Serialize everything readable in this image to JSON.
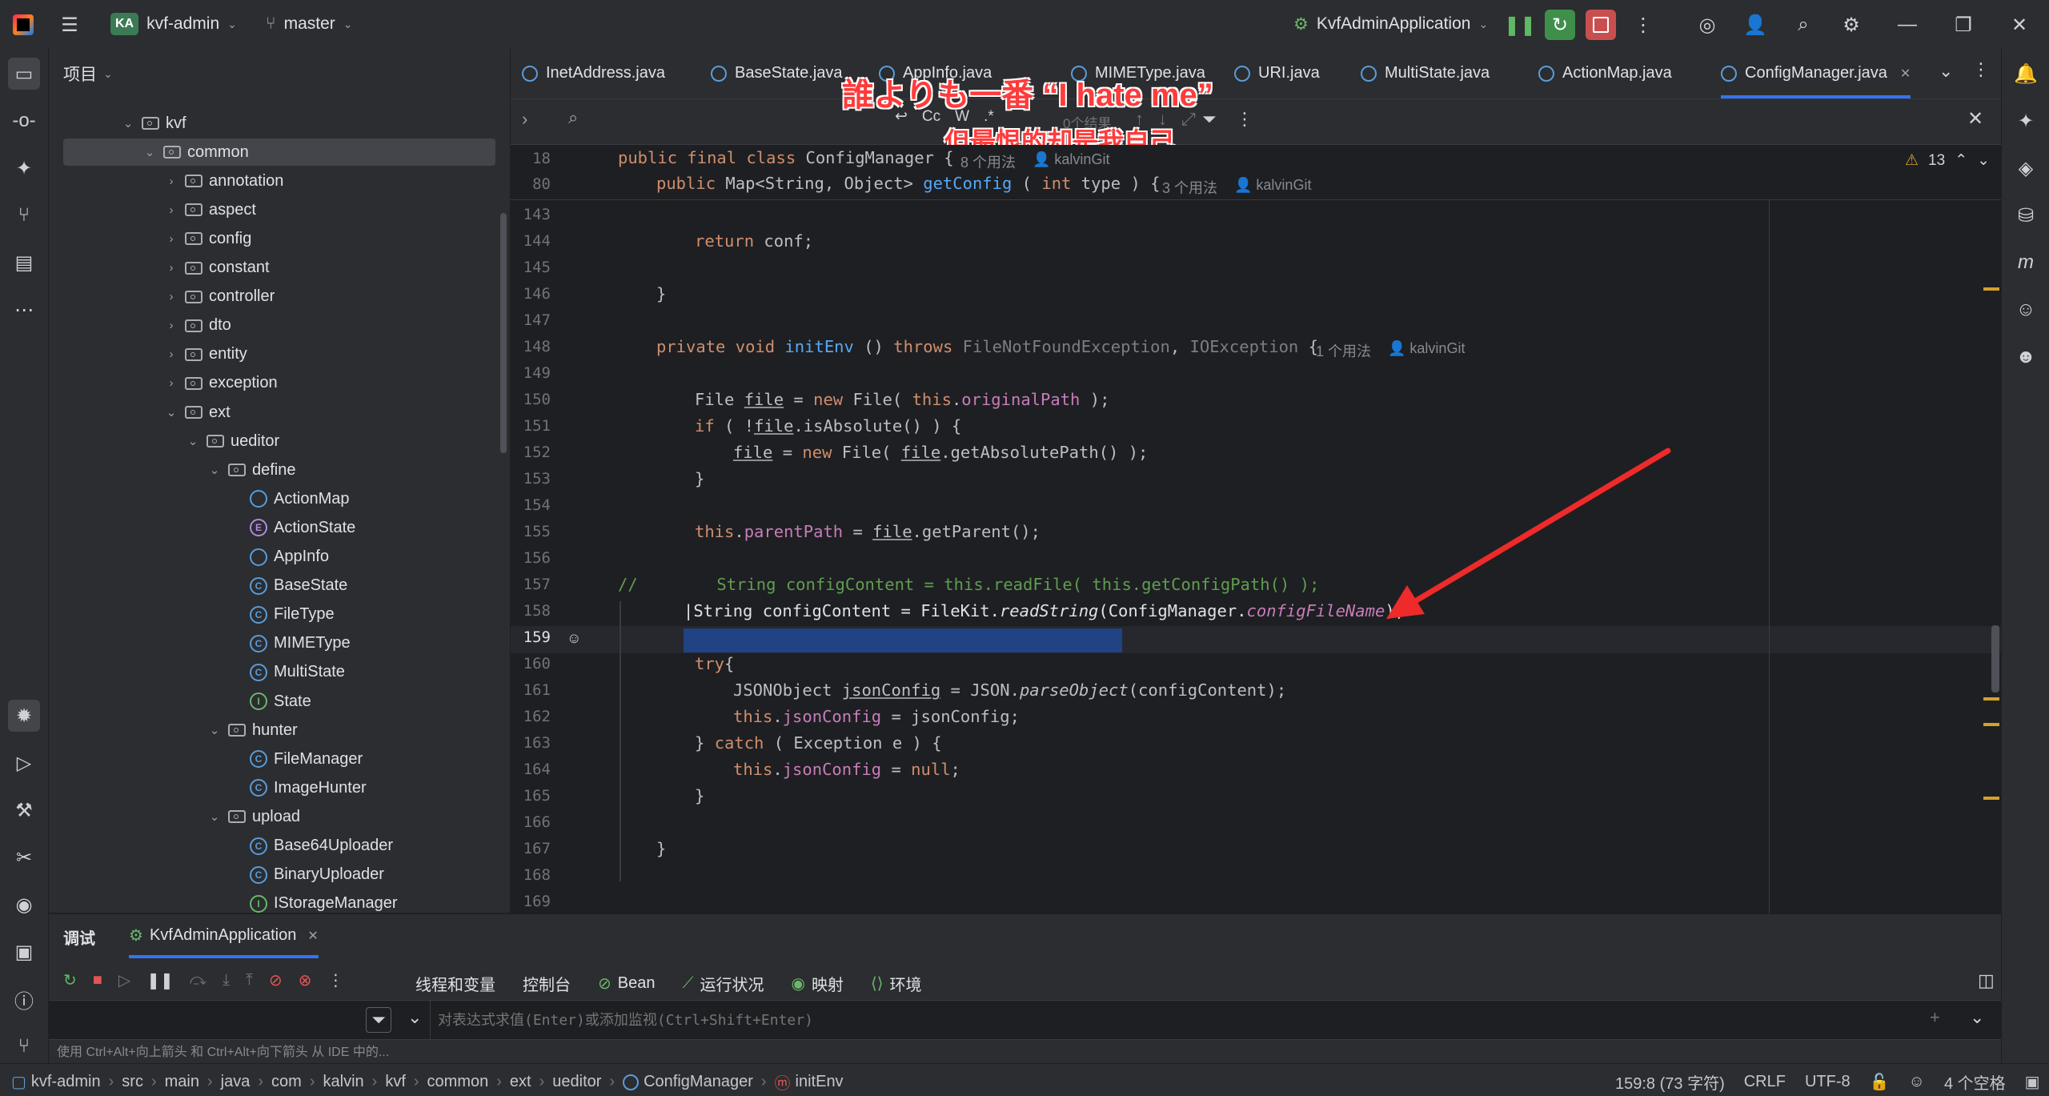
{
  "title_bar": {
    "project_badge": "KA",
    "project_name": "kvf-admin",
    "branch": "master",
    "run_config": "KvfAdminApplication"
  },
  "project_panel": {
    "title": "项目",
    "tree": [
      {
        "label": "kvf",
        "kind": "folder",
        "expanded": true
      },
      {
        "label": "common",
        "kind": "folder",
        "expanded": true
      },
      {
        "label": "annotation",
        "kind": "folder"
      },
      {
        "label": "aspect",
        "kind": "folder"
      },
      {
        "label": "config",
        "kind": "folder"
      },
      {
        "label": "constant",
        "kind": "folder"
      },
      {
        "label": "controller",
        "kind": "folder"
      },
      {
        "label": "dto",
        "kind": "folder"
      },
      {
        "label": "entity",
        "kind": "folder"
      },
      {
        "label": "exception",
        "kind": "folder"
      },
      {
        "label": "ext",
        "kind": "folder",
        "expanded": true
      },
      {
        "label": "ueditor",
        "kind": "folder",
        "expanded": true
      },
      {
        "label": "define",
        "kind": "folder",
        "expanded": true
      },
      {
        "label": "ActionMap",
        "kind": "class"
      },
      {
        "label": "ActionState",
        "kind": "enum",
        "glyph": "E"
      },
      {
        "label": "AppInfo",
        "kind": "class"
      },
      {
        "label": "BaseState",
        "kind": "class",
        "glyph": "C"
      },
      {
        "label": "FileType",
        "kind": "class",
        "glyph": "C"
      },
      {
        "label": "MIMEType",
        "kind": "class",
        "glyph": "C"
      },
      {
        "label": "MultiState",
        "kind": "class",
        "glyph": "C"
      },
      {
        "label": "State",
        "kind": "interface",
        "glyph": "I"
      },
      {
        "label": "hunter",
        "kind": "folder",
        "expanded": true
      },
      {
        "label": "FileManager",
        "kind": "class",
        "glyph": "C"
      },
      {
        "label": "ImageHunter",
        "kind": "class",
        "glyph": "C"
      },
      {
        "label": "upload",
        "kind": "folder",
        "expanded": true
      },
      {
        "label": "Base64Uploader",
        "kind": "class",
        "glyph": "C"
      },
      {
        "label": "BinaryUploader",
        "kind": "class",
        "glyph": "C"
      },
      {
        "label": "IStorageManager",
        "kind": "interface",
        "glyph": "I"
      }
    ]
  },
  "editor_tabs": [
    {
      "label": "InetAddress.java"
    },
    {
      "label": "BaseState.java"
    },
    {
      "label": "AppInfo.java"
    },
    {
      "label": "MIMEType.java"
    },
    {
      "label": "URI.java"
    },
    {
      "label": "MultiState.java"
    },
    {
      "label": "ActionMap.java"
    },
    {
      "label": "ConfigManager.java",
      "active": true
    }
  ],
  "find_bar": {
    "case_toggle": "Cc",
    "word_toggle": "W",
    "regex_toggle": ".*",
    "results": "0个结果"
  },
  "editor": {
    "warning_count": "13",
    "sticky": [
      {
        "line": "18",
        "code_kw": "public final class ",
        "code_name": "ConfigManager",
        "code_rest": " {",
        "usages": "8 个用法",
        "author": "kalvinGit"
      },
      {
        "line": "80",
        "usages": "3 个用法",
        "author": "kalvinGit"
      }
    ],
    "init_env_usages": "1 个用法",
    "init_env_author": "kalvinGit",
    "lines": [
      "143",
      "144",
      "145",
      "146",
      "147",
      "148",
      "149",
      "150",
      "151",
      "152",
      "153",
      "154",
      "155",
      "156",
      "157",
      "158",
      "159",
      "160",
      "161",
      "162",
      "163",
      "164",
      "165",
      "166",
      "167",
      "168",
      "169"
    ]
  },
  "overlay": {
    "line1": "誰よりも一番 “I hate me”",
    "line2": "但最恨的却是我自己"
  },
  "debug_panel": {
    "title": "调试",
    "session": "KvfAdminApplication",
    "tabs": [
      "线程和变量",
      "控制台",
      "Bean",
      "运行状况",
      "映射",
      "环境"
    ],
    "eval_placeholder": "对表达式求值(Enter)或添加监视(Ctrl+Shift+Enter)",
    "hint": "使用 Ctrl+Alt+向上箭头 和 Ctrl+Alt+向下箭头 从 IDE 中的..."
  },
  "status_bar": {
    "breadcrumbs": [
      "kvf-admin",
      "src",
      "main",
      "java",
      "com",
      "kalvin",
      "kvf",
      "common",
      "ext",
      "ueditor",
      "ConfigManager",
      "initEnv"
    ],
    "position": "159:8 (73 字符)",
    "line_sep": "CRLF",
    "encoding": "UTF-8",
    "indent": "4 个空格"
  }
}
